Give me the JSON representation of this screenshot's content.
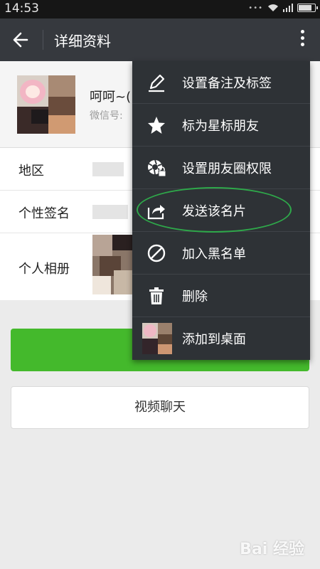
{
  "status_bar": {
    "time": "14:53"
  },
  "header": {
    "title": "详细资料"
  },
  "profile": {
    "name": "呵呵~(",
    "wechat_id_label": "微信号:"
  },
  "info": {
    "region_label": "地区",
    "signature_label": "个性签名",
    "album_label": "个人相册"
  },
  "buttons": {
    "video_chat": "视频聊天"
  },
  "menu": {
    "items": [
      {
        "label": "设置备注及标签",
        "icon": "pencil-icon"
      },
      {
        "label": "标为星标朋友",
        "icon": "star-icon"
      },
      {
        "label": "设置朋友圈权限",
        "icon": "moments-lock-icon"
      },
      {
        "label": "发送该名片",
        "icon": "share-icon"
      },
      {
        "label": "加入黑名单",
        "icon": "block-icon"
      },
      {
        "label": "删除",
        "icon": "trash-icon"
      },
      {
        "label": "添加到桌面",
        "icon": "avatar-thumbnail"
      }
    ]
  },
  "annotation": {
    "highlight_color": "#2ea84a"
  },
  "watermark": {
    "text": "Bai 经验"
  },
  "colors": {
    "title_bar": "#36393e",
    "menu_bg": "#2e3236",
    "primary_green": "#44b92c"
  }
}
